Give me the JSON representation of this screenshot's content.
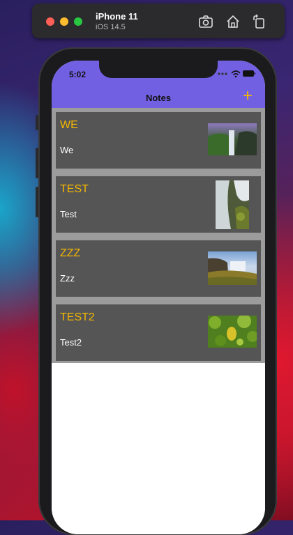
{
  "simulator": {
    "device": "iPhone 11",
    "os": "iOS 14.5",
    "toolbar_icons": [
      "screenshot-icon",
      "home-icon",
      "rotate-icon"
    ]
  },
  "status_bar": {
    "time": "5:02"
  },
  "nav": {
    "title": "Notes",
    "add_label": "+"
  },
  "colors": {
    "nav_background": "#7161e2",
    "card_background": "#555555",
    "title_color": "#f5b800",
    "list_background": "#9c9c9c"
  },
  "notes": [
    {
      "title": "WE",
      "body": "We",
      "thumbnail": "waterfall-cliff-image"
    },
    {
      "title": "TEST",
      "body": "Test",
      "thumbnail": "waterfall-closeup-image"
    },
    {
      "title": "ZZZ",
      "body": "Zzz",
      "thumbnail": "waterfall-landscape-image"
    },
    {
      "title": "TEST2",
      "body": "Test2",
      "thumbnail": "green-fruit-image"
    }
  ]
}
